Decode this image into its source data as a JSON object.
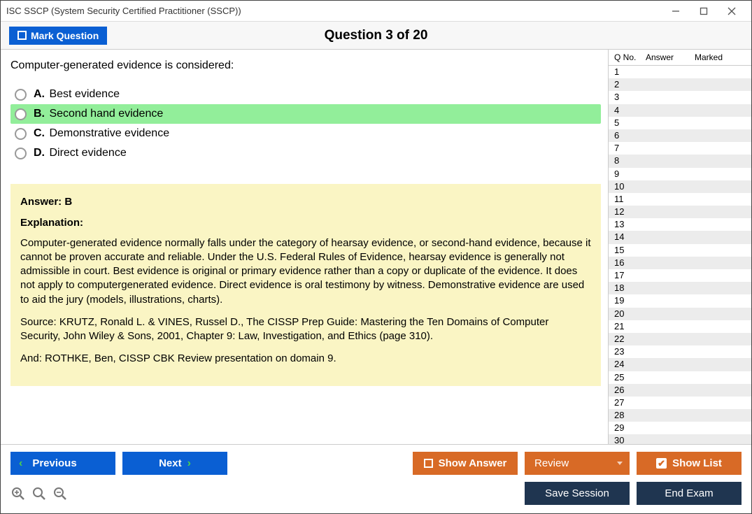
{
  "window_title": "ISC SSCP (System Security Certified Practitioner (SSCP))",
  "mark_button": "Mark Question",
  "question_header": "Question 3 of 20",
  "stem": "Computer-generated evidence is considered:",
  "options": {
    "A": {
      "letter": "A.",
      "text": "Best evidence"
    },
    "B": {
      "letter": "B.",
      "text": "Second hand evidence"
    },
    "C": {
      "letter": "C.",
      "text": "Demonstrative evidence"
    },
    "D": {
      "letter": "D.",
      "text": "Direct evidence"
    }
  },
  "answer_line": "Answer: B",
  "explanation_heading": "Explanation:",
  "explanation_p1": "Computer-generated evidence normally falls under the category of hearsay evidence, or second-hand evidence, because it cannot be proven accurate and reliable. Under the U.S. Federal Rules of Evidence, hearsay evidence is generally not admissible in court. Best evidence is original or primary evidence rather than a copy or duplicate of the evidence. It does not apply to computergenerated evidence. Direct evidence is oral testimony by witness. Demonstrative evidence are used to aid the jury (models, illustrations, charts).",
  "explanation_p2": "Source: KRUTZ, Ronald L. & VINES, Russel D., The CISSP Prep Guide: Mastering the Ten Domains of Computer Security, John Wiley & Sons, 2001, Chapter 9: Law, Investigation, and Ethics (page 310).",
  "explanation_p3": "And: ROTHKE, Ben, CISSP CBK Review presentation on domain 9.",
  "side": {
    "h1": "Q No.",
    "h2": "Answer",
    "h3": "Marked",
    "rows": [
      "1",
      "2",
      "3",
      "4",
      "5",
      "6",
      "7",
      "8",
      "9",
      "10",
      "11",
      "12",
      "13",
      "14",
      "15",
      "16",
      "17",
      "18",
      "19",
      "20",
      "21",
      "22",
      "23",
      "24",
      "25",
      "26",
      "27",
      "28",
      "29",
      "30"
    ]
  },
  "buttons": {
    "previous": "Previous",
    "next": "Next",
    "show_answer": "Show Answer",
    "review": "Review",
    "show_list": "Show List",
    "save_session": "Save Session",
    "end_exam": "End Exam"
  }
}
